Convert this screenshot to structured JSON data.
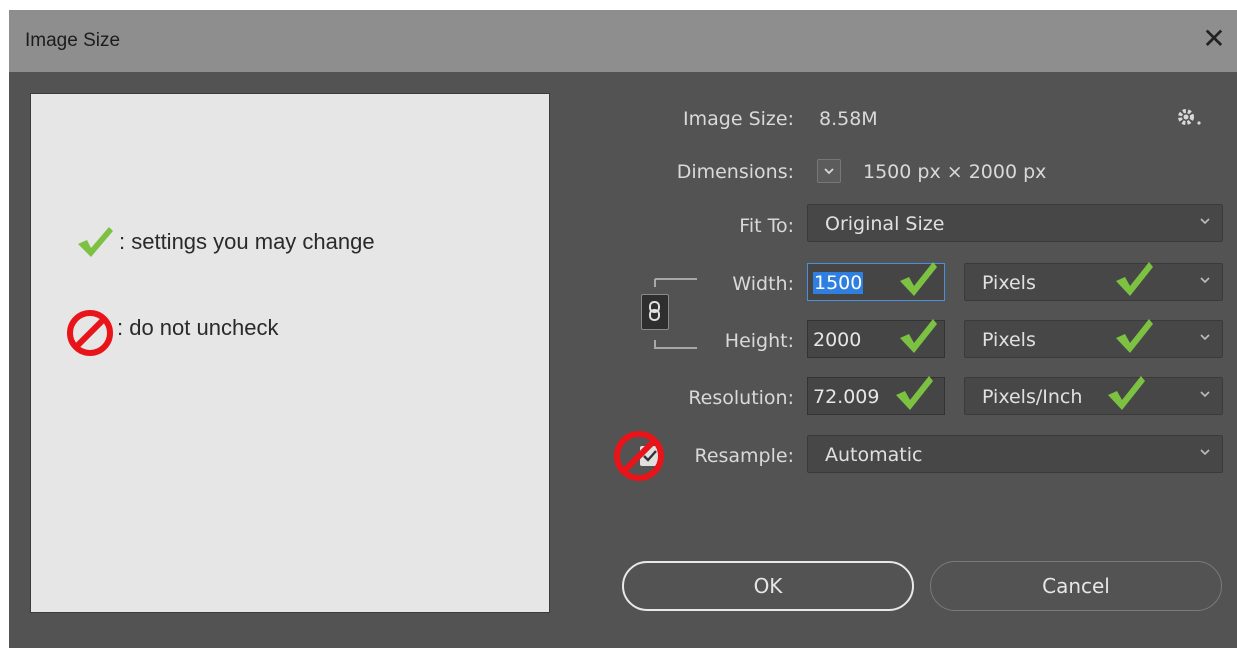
{
  "window": {
    "title": "Image Size",
    "close_glyph": "✕"
  },
  "legend": {
    "change_text": ": settings you may change",
    "nouncheck_text": ": do not uncheck"
  },
  "info": {
    "image_size_label": "Image Size:",
    "image_size_value": "8.58M",
    "dimensions_label": "Dimensions:",
    "dimensions_value": "1500 px  ×  2000 px"
  },
  "fit_to": {
    "label": "Fit To:",
    "value": "Original Size"
  },
  "width": {
    "label": "Width:",
    "value": "1500",
    "unit": "Pixels"
  },
  "height": {
    "label": "Height:",
    "value": "2000",
    "unit": "Pixels"
  },
  "resolution": {
    "label": "Resolution:",
    "value": "72.009",
    "unit": "Pixels/Inch"
  },
  "resample": {
    "label": "Resample:",
    "value": "Automatic",
    "checked": true
  },
  "buttons": {
    "ok": "OK",
    "cancel": "Cancel"
  },
  "colors": {
    "dialog_bg": "#535353",
    "titlebar_bg": "#8e8e8e",
    "check_green": "#7cc142",
    "prohibit_red": "#e8141a",
    "focus_blue": "#2f7fe0"
  },
  "icons": {
    "settings": "gear-icon",
    "link": "chain-link-icon",
    "check": "green-checkmark-icon",
    "prohibit": "prohibited-icon"
  }
}
